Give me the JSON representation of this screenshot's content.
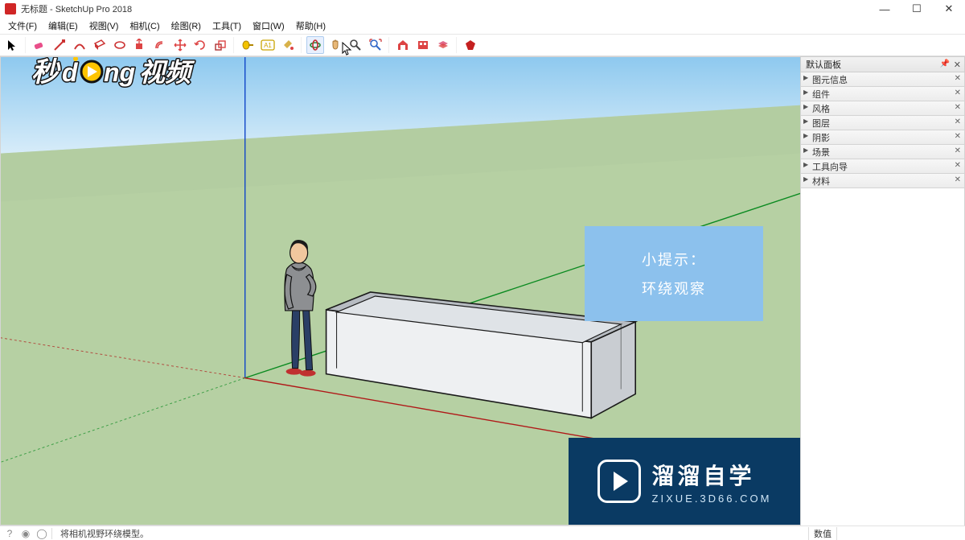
{
  "title": "无标题 - SketchUp Pro 2018",
  "menu": [
    "文件(F)",
    "编辑(E)",
    "视图(V)",
    "相机(C)",
    "绘图(R)",
    "工具(T)",
    "窗口(W)",
    "帮助(H)"
  ],
  "toolbar": [
    {
      "name": "select-tool",
      "active": false
    },
    {
      "name": "eraser-tool",
      "active": false
    },
    {
      "name": "line-tool",
      "active": false
    },
    {
      "name": "arc-tool",
      "active": false
    },
    {
      "name": "rectangle-tool",
      "active": false
    },
    {
      "name": "circle-tool",
      "active": false
    },
    {
      "name": "pushpull-tool",
      "active": false
    },
    {
      "name": "offset-tool",
      "active": false
    },
    {
      "name": "move-tool",
      "active": false
    },
    {
      "name": "rotate-tool",
      "active": false
    },
    {
      "name": "scale-tool",
      "active": false
    },
    {
      "name": "tape-measure-tool",
      "active": false
    },
    {
      "name": "text-tool",
      "active": false
    },
    {
      "name": "paint-bucket-tool",
      "active": false
    },
    {
      "name": "orbit-tool",
      "active": true
    },
    {
      "name": "pan-tool",
      "active": false
    },
    {
      "name": "zoom-tool",
      "active": false
    },
    {
      "name": "zoom-extents-tool",
      "active": false
    },
    {
      "name": "warehouse-tool",
      "active": false
    },
    {
      "name": "extension-warehouse-tool",
      "active": false
    },
    {
      "name": "layers-tool",
      "active": false
    },
    {
      "name": "ruby-tool",
      "active": false
    }
  ],
  "tray": {
    "title": "默认面板",
    "panels": [
      "图元信息",
      "组件",
      "风格",
      "图层",
      "阴影",
      "场景",
      "工具向导",
      "材料"
    ]
  },
  "hint": {
    "line1": "小提示：",
    "line2": "环绕观察"
  },
  "brand": {
    "title": "溜溜自学",
    "sub": "ZIXUE.3D66.COM"
  },
  "watermark_text": "秒dong视频",
  "status": {
    "hint": "将相机视野环绕模型。",
    "measure_label": "数值"
  }
}
